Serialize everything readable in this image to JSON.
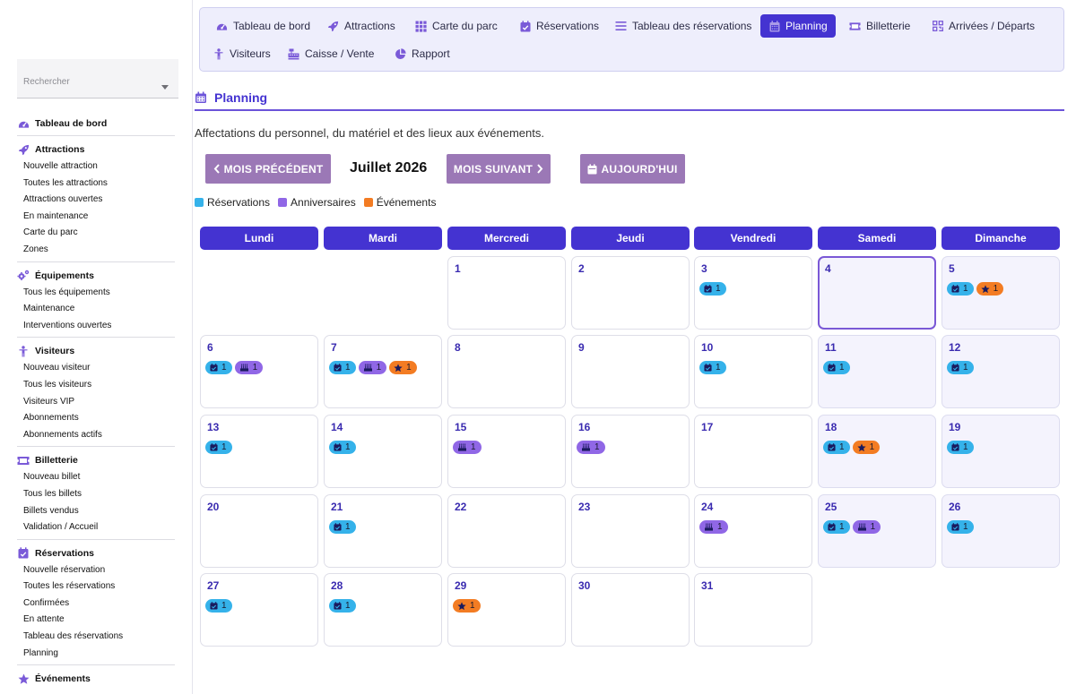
{
  "sidebar": {
    "search_placeholder": "Rechercher",
    "sections": [
      {
        "title": "Tableau de bord",
        "icon": "dashboard-icon",
        "items": []
      },
      {
        "title": "Attractions",
        "icon": "rocket-icon",
        "items": [
          "Nouvelle attraction",
          "Toutes les attractions",
          "Attractions ouvertes",
          "En maintenance",
          "Carte du parc",
          "Zones"
        ]
      },
      {
        "title": "Équipements",
        "icon": "gears-icon",
        "items": [
          "Tous les équipements",
          "Maintenance",
          "Interventions ouvertes"
        ]
      },
      {
        "title": "Visiteurs",
        "icon": "person-icon",
        "items": [
          "Nouveau visiteur",
          "Tous les visiteurs",
          "Visiteurs VIP",
          "Abonnements",
          "Abonnements actifs"
        ]
      },
      {
        "title": "Billetterie",
        "icon": "ticket-icon",
        "items": [
          "Nouveau billet",
          "Tous les billets",
          "Billets vendus",
          "Validation / Accueil"
        ]
      },
      {
        "title": "Réservations",
        "icon": "calendar-check-icon",
        "items": [
          "Nouvelle réservation",
          "Toutes les réservations",
          "Confirmées",
          "En attente",
          "Tableau des réservations",
          "Planning"
        ]
      },
      {
        "title": "Événements",
        "icon": "star-icon",
        "items": []
      }
    ]
  },
  "tabs": [
    {
      "label": "Tableau de bord",
      "icon": "dashboard-icon",
      "active": false
    },
    {
      "label": "Attractions",
      "icon": "rocket-icon",
      "active": false
    },
    {
      "label": "Carte du parc",
      "icon": "grid-icon",
      "active": false
    },
    {
      "label": "Réservations",
      "icon": "calendar-check-icon",
      "active": false
    },
    {
      "label": "Tableau des réservations",
      "icon": "list-icon",
      "active": false
    },
    {
      "label": "Planning",
      "icon": "calendar-icon",
      "active": true
    },
    {
      "label": "Billetterie",
      "icon": "ticket-icon",
      "active": false
    },
    {
      "label": "Arrivées / Départs",
      "icon": "qr-icon",
      "active": false
    },
    {
      "label": "Visiteurs",
      "icon": "person-icon",
      "active": false
    },
    {
      "label": "Caisse / Vente",
      "icon": "cash-register-icon",
      "active": false
    },
    {
      "label": "Rapport",
      "icon": "pie-icon",
      "active": false
    }
  ],
  "page": {
    "title": "Planning",
    "subtitle": "Affectations du personnel, du matériel et des lieux aux événements."
  },
  "controls": {
    "prev_label": "MOIS PRÉCÉDENT",
    "month_label": "Juillet 2026",
    "next_label": "MOIS SUIVANT",
    "today_label": "AUJOURD'HUI"
  },
  "legend": [
    {
      "label": "Réservations",
      "color": "#35b2ea"
    },
    {
      "label": "Anniversaires",
      "color": "#9067e6"
    },
    {
      "label": "Événements",
      "color": "#f37c23"
    }
  ],
  "colors": {
    "primary": "#4433d1",
    "reservation": "#35b2ea",
    "anniversary": "#9067e6",
    "event": "#f37c23",
    "button": "#9b78b6"
  },
  "weekdays": [
    "Lundi",
    "Mardi",
    "Mercredi",
    "Jeudi",
    "Vendredi",
    "Samedi",
    "Dimanche"
  ],
  "calendar": {
    "first_weekday_index": 2,
    "today": 4,
    "days": [
      {
        "day": "1",
        "badges": []
      },
      {
        "day": "2",
        "badges": []
      },
      {
        "day": "3",
        "badges": [
          {
            "type": "res",
            "count": "1"
          }
        ]
      },
      {
        "day": "4",
        "badges": []
      },
      {
        "day": "5",
        "badges": [
          {
            "type": "res",
            "count": "1"
          },
          {
            "type": "evt",
            "count": "1"
          }
        ]
      },
      {
        "day": "6",
        "badges": [
          {
            "type": "res",
            "count": "1"
          },
          {
            "type": "ann",
            "count": "1"
          }
        ]
      },
      {
        "day": "7",
        "badges": [
          {
            "type": "res",
            "count": "1"
          },
          {
            "type": "ann",
            "count": "1"
          },
          {
            "type": "evt",
            "count": "1"
          }
        ]
      },
      {
        "day": "8",
        "badges": []
      },
      {
        "day": "9",
        "badges": []
      },
      {
        "day": "10",
        "badges": [
          {
            "type": "res",
            "count": "1"
          }
        ]
      },
      {
        "day": "11",
        "badges": [
          {
            "type": "res",
            "count": "1"
          }
        ]
      },
      {
        "day": "12",
        "badges": [
          {
            "type": "res",
            "count": "1"
          }
        ]
      },
      {
        "day": "13",
        "badges": [
          {
            "type": "res",
            "count": "1"
          }
        ]
      },
      {
        "day": "14",
        "badges": [
          {
            "type": "res",
            "count": "1"
          }
        ]
      },
      {
        "day": "15",
        "badges": [
          {
            "type": "ann",
            "count": "1"
          }
        ]
      },
      {
        "day": "16",
        "badges": [
          {
            "type": "ann",
            "count": "1"
          }
        ]
      },
      {
        "day": "17",
        "badges": []
      },
      {
        "day": "18",
        "badges": [
          {
            "type": "res",
            "count": "1"
          },
          {
            "type": "evt",
            "count": "1"
          }
        ]
      },
      {
        "day": "19",
        "badges": [
          {
            "type": "res",
            "count": "1"
          }
        ]
      },
      {
        "day": "20",
        "badges": []
      },
      {
        "day": "21",
        "badges": [
          {
            "type": "res",
            "count": "1"
          }
        ]
      },
      {
        "day": "22",
        "badges": []
      },
      {
        "day": "23",
        "badges": []
      },
      {
        "day": "24",
        "badges": [
          {
            "type": "ann",
            "count": "1"
          }
        ]
      },
      {
        "day": "25",
        "badges": [
          {
            "type": "res",
            "count": "1"
          },
          {
            "type": "ann",
            "count": "1"
          }
        ]
      },
      {
        "day": "26",
        "badges": [
          {
            "type": "res",
            "count": "1"
          }
        ]
      },
      {
        "day": "27",
        "badges": [
          {
            "type": "res",
            "count": "1"
          }
        ]
      },
      {
        "day": "28",
        "badges": [
          {
            "type": "res",
            "count": "1"
          }
        ]
      },
      {
        "day": "29",
        "badges": [
          {
            "type": "evt",
            "count": "1"
          }
        ]
      },
      {
        "day": "30",
        "badges": []
      },
      {
        "day": "31",
        "badges": []
      }
    ]
  }
}
